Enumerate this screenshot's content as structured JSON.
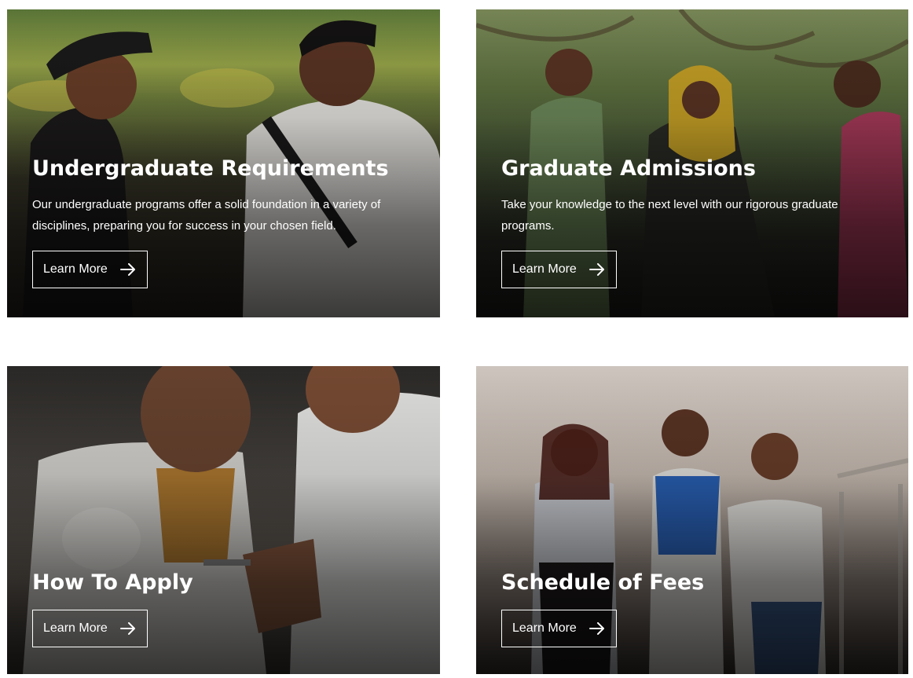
{
  "cards": [
    {
      "title": "Undergraduate Requirements",
      "description": "Our undergraduate programs offer a solid foundation in a variety of disciplines, preparing you for success in your chosen field.",
      "button_label": "Learn More",
      "button_icon": "arrow-right-icon"
    },
    {
      "title": "Graduate Admissions",
      "description": "Take your knowledge to the next level with our rigorous graduate programs.",
      "button_label": "Learn More",
      "button_icon": "arrow-right-icon"
    },
    {
      "title": "How To Apply",
      "description": "",
      "button_label": "Learn More",
      "button_icon": "arrow-right-icon"
    },
    {
      "title": "Schedule of Fees",
      "description": "",
      "button_label": "Learn More",
      "button_icon": "arrow-right-icon"
    }
  ],
  "colors": {
    "text": "#ffffff",
    "page_background": "#ffffff"
  }
}
